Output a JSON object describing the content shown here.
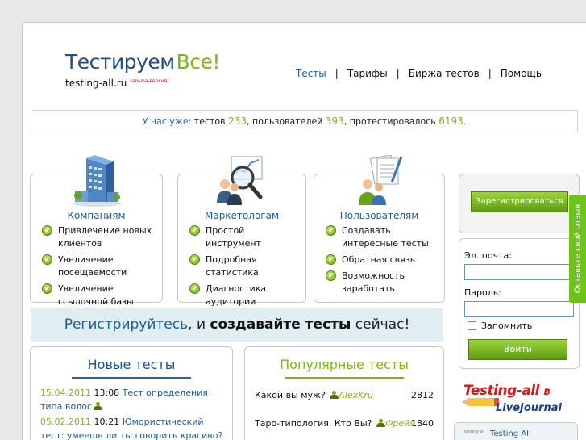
{
  "logo": {
    "word1": "Тестируем",
    "word2": "Все!",
    "domain": "testing-all.ru",
    "beta": "(альфа-версия)"
  },
  "nav": {
    "items": [
      "Тесты",
      "Тарифы",
      "Биржа тестов",
      "Помощь"
    ],
    "separator": "|",
    "active": "Тесты"
  },
  "stats": {
    "label": "У нас уже:",
    "tests_label": "тестов",
    "tests": "233",
    "users_label": ", пользователей",
    "users": "393",
    "tested_label": ", протестировалось",
    "tested": "6193",
    "end": "."
  },
  "features": [
    {
      "title": "Компаниям",
      "items": [
        "Привлечение новых клиентов",
        "Увеличение посещаемости",
        "Увеличение ссылочной базы"
      ]
    },
    {
      "title": "Маркетологам",
      "items": [
        "Простой инструмент",
        "Подробная статистика",
        "Диагностика аудитории"
      ]
    },
    {
      "title": "Пользователям",
      "items": [
        "Создавать интересные тесты",
        "Обратная связь",
        "Возможность заработать"
      ]
    }
  ],
  "banner": {
    "part1": "Регистрируйтесь",
    "part2": ", и ",
    "part3": "создавайте тесты",
    "part4": " сейчас!"
  },
  "new_tests": {
    "title": "Новые тесты",
    "items": [
      {
        "date": "15.04.2011",
        "time": "13:08",
        "title": "Тест определения типа волос"
      },
      {
        "date": "05.02.2011",
        "time": "10:21",
        "title": "Юмористический тест: умеешь ли ты говорить красиво?"
      }
    ]
  },
  "popular_tests": {
    "title": "Популярные тесты",
    "items": [
      {
        "title": "Какой вы муж?",
        "author": "AlexKru",
        "count": "2812"
      },
      {
        "title": "Таро-типология. Кто Вы?",
        "author": "Фрейя",
        "count": "1840"
      }
    ]
  },
  "sidebar": {
    "register": "Зарегистрироваться",
    "email_label": "Эл. почта:",
    "password_label": "Пароль:",
    "remember": "Запомнить",
    "login": "Войти"
  },
  "feedback": "Оставьте свой отзыв",
  "livejournal": {
    "brand": "Testing-all",
    "in": "в",
    "lj": "LiveJournal"
  },
  "lj_widget": {
    "avatar_text": "testing-all",
    "name": "Testing All"
  },
  "colors": {
    "blue": "#1e5d9c",
    "green": "#7fb51b",
    "feedback": "#6dc21b"
  }
}
